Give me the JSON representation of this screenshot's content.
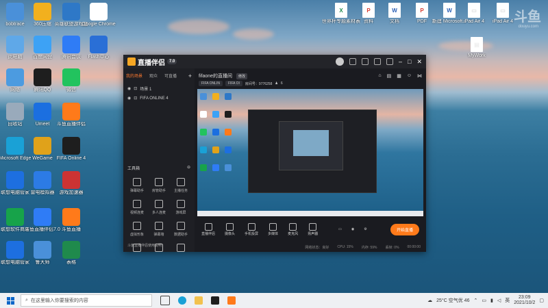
{
  "desktop": {
    "left_icons": [
      {
        "label": "bobtrace",
        "color": "#4a90d9"
      },
      {
        "label": "360压缩",
        "color": "#f2b01e"
      },
      {
        "label": "英雄联盟游戏盒",
        "color": "#2e78c7"
      },
      {
        "label": "Google Chrome",
        "color": "#ffffff"
      },
      {
        "label": "此电脑",
        "color": "#5fa8e8"
      },
      {
        "label": "百度网盘",
        "color": "#3da2f5"
      },
      {
        "label": "腾讯会议",
        "color": "#2f7cf6"
      },
      {
        "label": "Flash中心",
        "color": "#2a6fd6"
      },
      {
        "label": "网络",
        "color": "#4c9be0"
      },
      {
        "label": "腾讯QQ",
        "color": "#1e1e1e"
      },
      {
        "label": "微信",
        "color": "#22c35e"
      },
      {
        "label": "回收站",
        "color": "#9ab"
      },
      {
        "label": "Umeet",
        "color": "#1b6fe0"
      },
      {
        "label": "斗鱼直播伴侣",
        "color": "#ff7a1a"
      },
      {
        "label": "Microsoft Edge",
        "color": "#1aa1d6"
      },
      {
        "label": "WeGame",
        "color": "#e0a21a"
      },
      {
        "label": "FIFA Online 4",
        "color": "#1e1e1e"
      },
      {
        "label": "联想电脑管家",
        "color": "#1d6fe0"
      },
      {
        "label": "雷电模拟器",
        "color": "#2c7be5"
      },
      {
        "label": "游戏加速器",
        "color": "#c33"
      },
      {
        "label": "联想软件商店",
        "color": "#17a34a"
      },
      {
        "label": "斗鱼直播伴侣7.0",
        "color": "#2f7cf6"
      },
      {
        "label": "斗鱼直播",
        "color": "#ff7a1a"
      },
      {
        "label": "联想电脑管家",
        "color": "#1d6fe0"
      },
      {
        "label": "鲁大师",
        "color": "#4a90d9"
      },
      {
        "label": "表格",
        "color": "#1f8a4c"
      }
    ],
    "right_icons": [
      {
        "label": "世界杯专题素材表格",
        "type": "X",
        "color": "#1f8a4c"
      },
      {
        "label": "资料",
        "type": "P",
        "color": "#d73b2f"
      },
      {
        "label": "文档",
        "type": "W",
        "color": "#2b5fb4"
      },
      {
        "label": "PDF",
        "type": "P",
        "color": "#d73b2f"
      },
      {
        "label": "新建 Microsoft...",
        "type": "W",
        "color": "#2b5fb4"
      },
      {
        "label": "iPad Air 4",
        "type": "▭",
        "color": "#ddd"
      },
      {
        "label": "iPad Air 4",
        "type": "▭",
        "color": "#ddd"
      },
      {
        "label": "MyWork",
        "type": "▤",
        "color": "#eee"
      }
    ],
    "watermark": "斗鱼",
    "watermark_sub": "douyu.com"
  },
  "app": {
    "title": "直播伴侣",
    "version": "7.0",
    "tabs": [
      "我的场景",
      "观众",
      "可直播"
    ],
    "scenes": [
      "场景 1",
      "FIFA ONLINE 4"
    ],
    "tools_title": "工具箱",
    "tools": [
      "弹幕助手",
      "房管助手",
      "主播任务",
      "视频连麦",
      "多人连麦",
      "游戏屏",
      "虚拟形象",
      "弹幕墙",
      "数据助手",
      "",
      "",
      ""
    ],
    "footer": "斗鱼直播伴侣使用说明",
    "room_title": "fifaone的直播间",
    "room_edit": "修改",
    "tags": [
      "FIFA ONLIN",
      "FIFA OI"
    ],
    "room_id": "房间号：9776258",
    "viewer_count": "6",
    "controls": [
      "直播伴侣",
      "摄像头",
      "手机投屏",
      "多媒体",
      "麦克风",
      "扬声器"
    ],
    "go_live": "开始直播",
    "status_items": [
      "网络状态：良好",
      "CPU: 15%",
      "内存: 59%",
      "丢帧: 0%",
      "00:00:00"
    ]
  },
  "taskbar": {
    "search_placeholder": "在这里输入你要搜索的内容",
    "weather": "25°C 空气优 46",
    "time": "23:09",
    "date": "2021/10/2",
    "ime": "英"
  }
}
